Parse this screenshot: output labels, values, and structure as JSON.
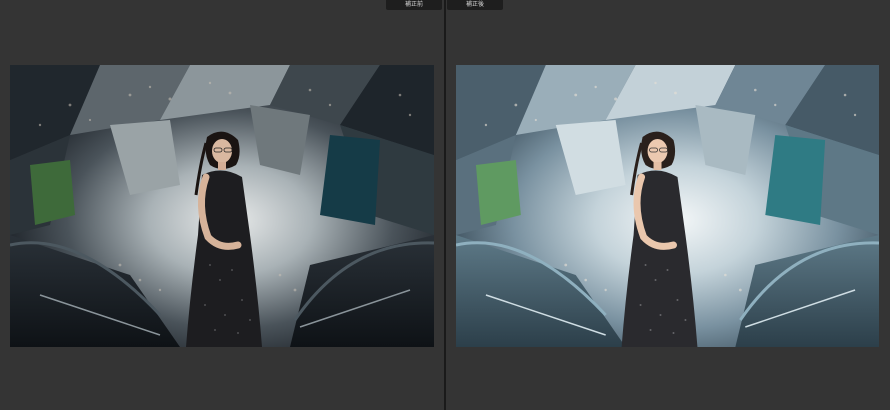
{
  "labels": {
    "before": "補正前",
    "after": "補正後"
  },
  "colors": {
    "background": "#333333",
    "divider": "#1a1a1a",
    "tab_background": "#1e1e1e",
    "tab_text": "#d6d6d6"
  },
  "photos": {
    "before": {
      "tone": "original",
      "description_icon": "photo-before"
    },
    "after": {
      "tone": "corrected",
      "description_icon": "photo-after"
    }
  }
}
